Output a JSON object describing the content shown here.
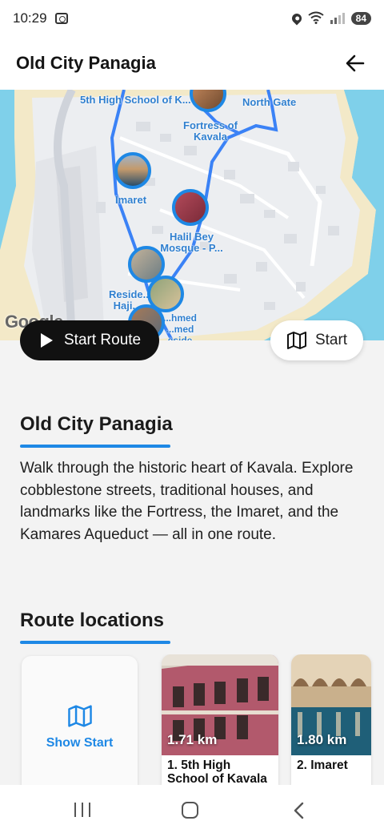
{
  "status_bar": {
    "time": "10:29",
    "battery": "84"
  },
  "app_bar": {
    "title": "Old City Panagia"
  },
  "map": {
    "labels": [
      "5th High School of K...",
      "North Gate",
      "Fortress of Kavala",
      "Imaret",
      "Halil Bey Mosque - P...",
      "Reside... Haji...",
      "...hmed ...med ...eside..."
    ],
    "attribution": "Google"
  },
  "buttons": {
    "start_route": "Start Route",
    "start": "Start"
  },
  "route": {
    "title": "Old City Panagia",
    "description": "Walk through the historic heart of Kavala. Explore cobblestone streets, traditional houses, and landmarks like the Fortress, the Imaret, and the Kamares Aqueduct — all in one route."
  },
  "locations_section": {
    "title": "Route locations",
    "show_start": "Show Start",
    "items": [
      {
        "distance": "1.71 km",
        "name": "1. 5th High School of Kavala"
      },
      {
        "distance": "1.80 km",
        "name": "2. Imaret"
      }
    ]
  },
  "colors": {
    "accent": "#1e88e5",
    "sea": "#7fd0ea",
    "land": "#eef0f2"
  }
}
